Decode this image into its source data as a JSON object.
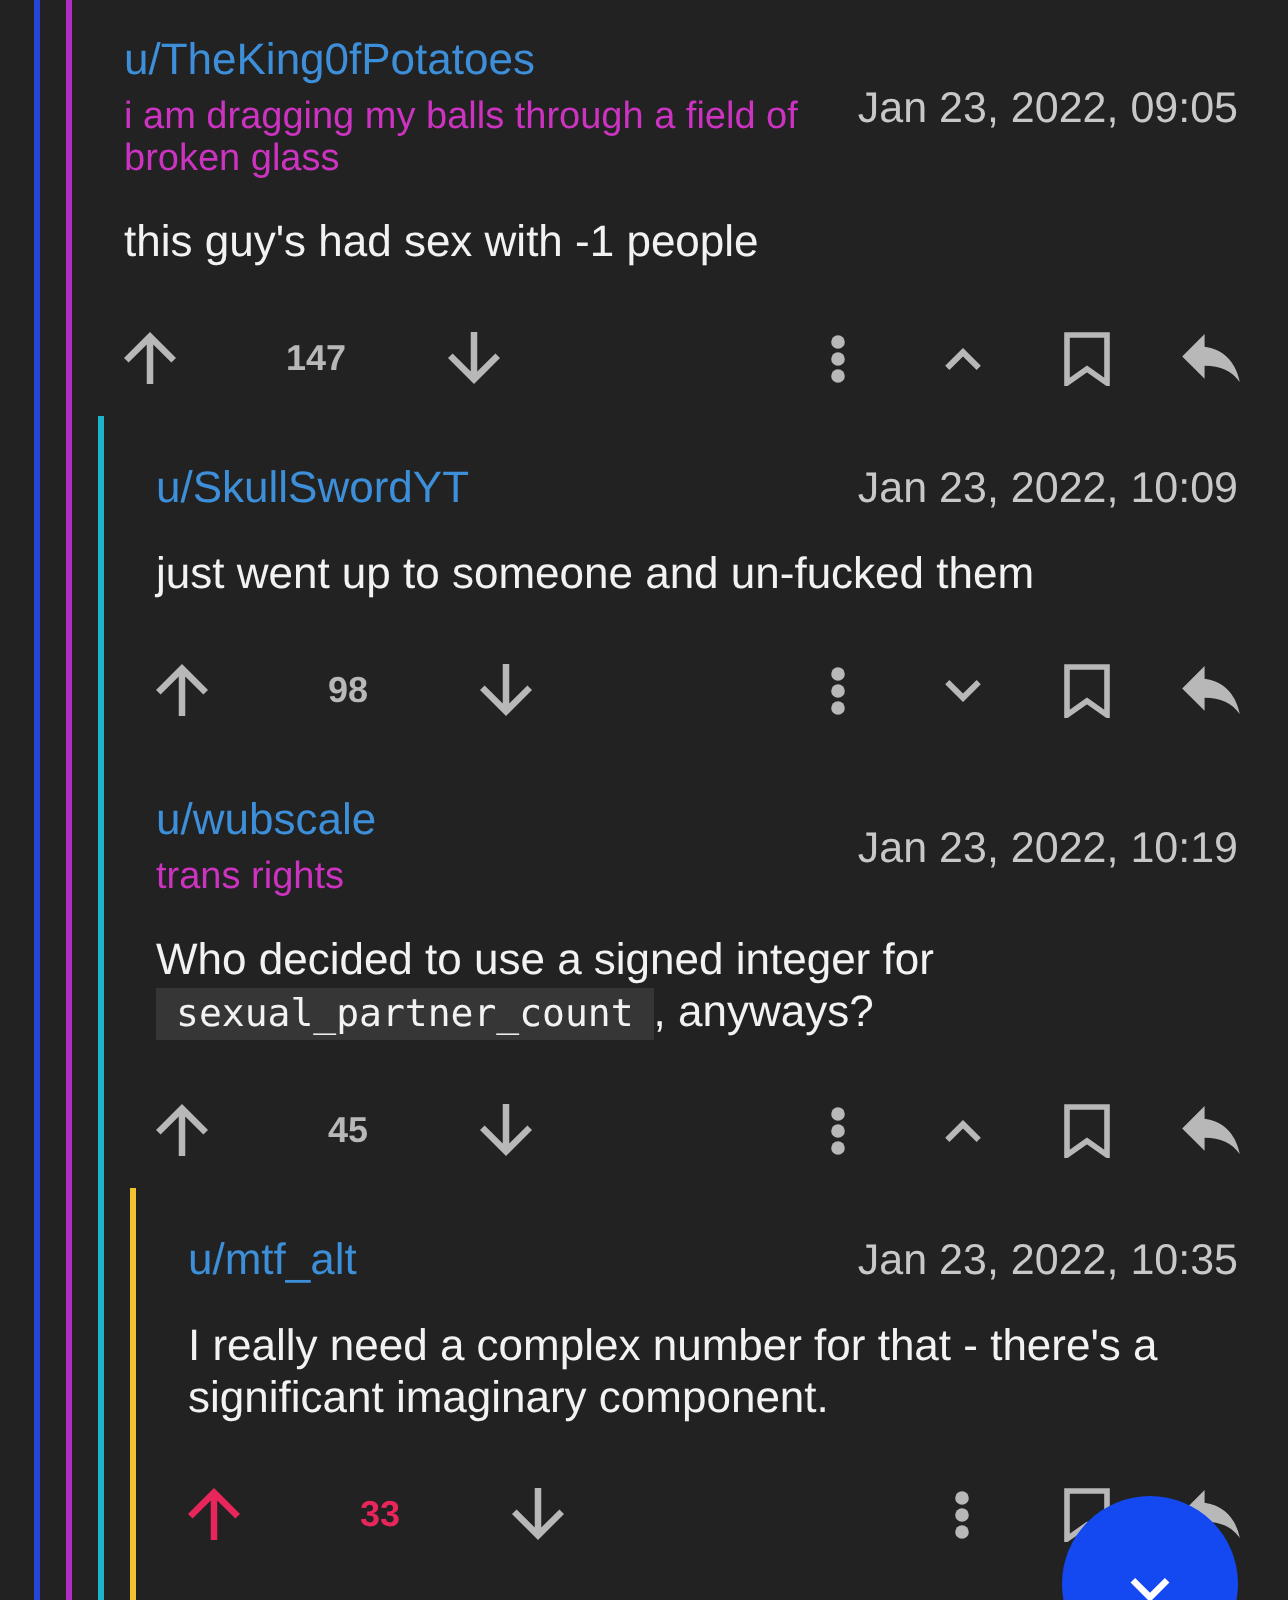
{
  "thread": {
    "color": "#2546d6",
    "children": [
      {
        "author": "u/TheKing0fPotatoes",
        "flair": "i am dragging my balls through a field of broken glass",
        "timestamp": "Jan 23, 2022, 09:05",
        "body": [
          {
            "kind": "text",
            "text": "this guy's had sex with -1 people"
          }
        ],
        "score": "147",
        "upvoted": false,
        "has_replies": true,
        "expanded": true,
        "color": "#b02ec6",
        "children": [
          {
            "author": "u/SkullSwordYT",
            "timestamp": "Jan 23, 2022, 10:09",
            "body": [
              {
                "kind": "text",
                "text": "just went up to someone and un-fucked them"
              }
            ],
            "score": "98",
            "upvoted": false,
            "has_replies": true,
            "expanded": false,
            "color": "#1fb5c9"
          },
          {
            "author": "u/wubscale",
            "flair": "trans rights",
            "timestamp": "Jan 23, 2022, 10:19",
            "body": [
              {
                "kind": "text",
                "text": "Who decided to use a signed integer for "
              },
              {
                "kind": "code",
                "text": "sexual_partner_count"
              },
              {
                "kind": "text",
                "text": ", anyways?"
              }
            ],
            "score": "45",
            "upvoted": false,
            "has_replies": true,
            "expanded": true,
            "color": "#1fb5c9",
            "children": [
              {
                "author": "u/mtf_alt",
                "timestamp": "Jan 23, 2022, 10:35",
                "body": [
                  {
                    "kind": "text",
                    "text": "I really need a complex number for that - there's a significant imaginary component."
                  }
                ],
                "score": "33",
                "upvoted": true,
                "has_replies": false,
                "color": "#f2c230"
              }
            ]
          }
        ]
      }
    ]
  }
}
